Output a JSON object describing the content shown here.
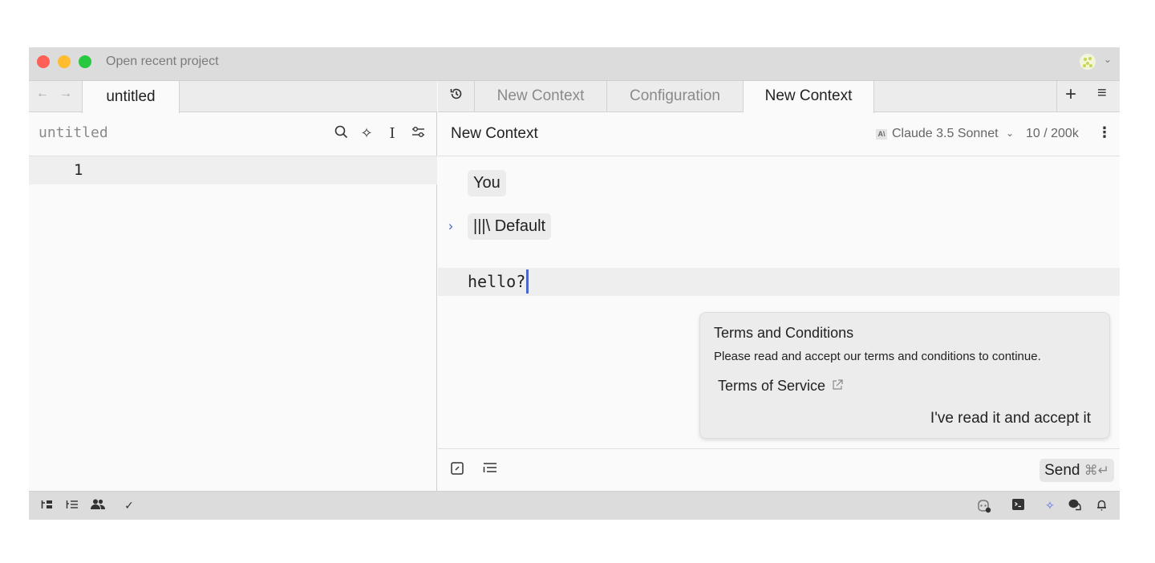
{
  "window": {
    "title": "Open recent project",
    "avatar_menu_icon": "chevron-down-icon"
  },
  "left_pane": {
    "nav": {
      "back": "←",
      "forward": "→"
    },
    "active_tab": "untitled",
    "editor_title": "untitled",
    "toolbar_icons": {
      "search": "⌕",
      "assistant": "✧",
      "cursor": "I",
      "settings": "⧳"
    },
    "lines": [
      {
        "number": "1",
        "text": ""
      }
    ]
  },
  "right_pane": {
    "history_icon": "↺",
    "tabs": [
      {
        "label": "New Context",
        "active": false
      },
      {
        "label": "Configuration",
        "active": false
      },
      {
        "label": "New Context",
        "active": true
      }
    ],
    "new_tab": "+",
    "menu": "≡",
    "context": {
      "title": "New Context",
      "model_badge": "A\\",
      "model": "Claude 3.5 Sonnet",
      "model_chevron": "⌄",
      "token_usage": "10 / 200k",
      "more": "⋮"
    },
    "messages": [
      {
        "role": "You"
      },
      {
        "role": "Default",
        "prefix": "|||\\",
        "expand": "›"
      }
    ],
    "input_text": "hello?",
    "terms": {
      "title": "Terms and Conditions",
      "body": "Please read and accept our terms and conditions to continue.",
      "link": "Terms of Service",
      "link_icon": "↗",
      "accept": "I've read it and accept it"
    },
    "composer": {
      "edit_icon": "✎",
      "outline_icon": "☰",
      "send_label": "Send",
      "send_shortcut": "⌘↵"
    }
  },
  "status_bar": {
    "left": [
      {
        "name": "project-panel",
        "glyph": "▤"
      },
      {
        "name": "outline-panel",
        "glyph": "☰"
      },
      {
        "name": "collab-panel",
        "glyph": "👥"
      },
      {
        "name": "diagnostics",
        "glyph": "✓"
      }
    ],
    "right": [
      {
        "name": "copilot",
        "glyph": "◎"
      },
      {
        "name": "terminal",
        "glyph": "▣"
      },
      {
        "name": "assistant",
        "glyph": "✧"
      },
      {
        "name": "chat",
        "glyph": "💬"
      },
      {
        "name": "notifications",
        "glyph": "🔔"
      }
    ]
  },
  "colors": {
    "accent": "#4a67c9",
    "traffic_red": "#fe5f57",
    "traffic_yellow": "#febc2e",
    "traffic_green": "#28c840"
  }
}
